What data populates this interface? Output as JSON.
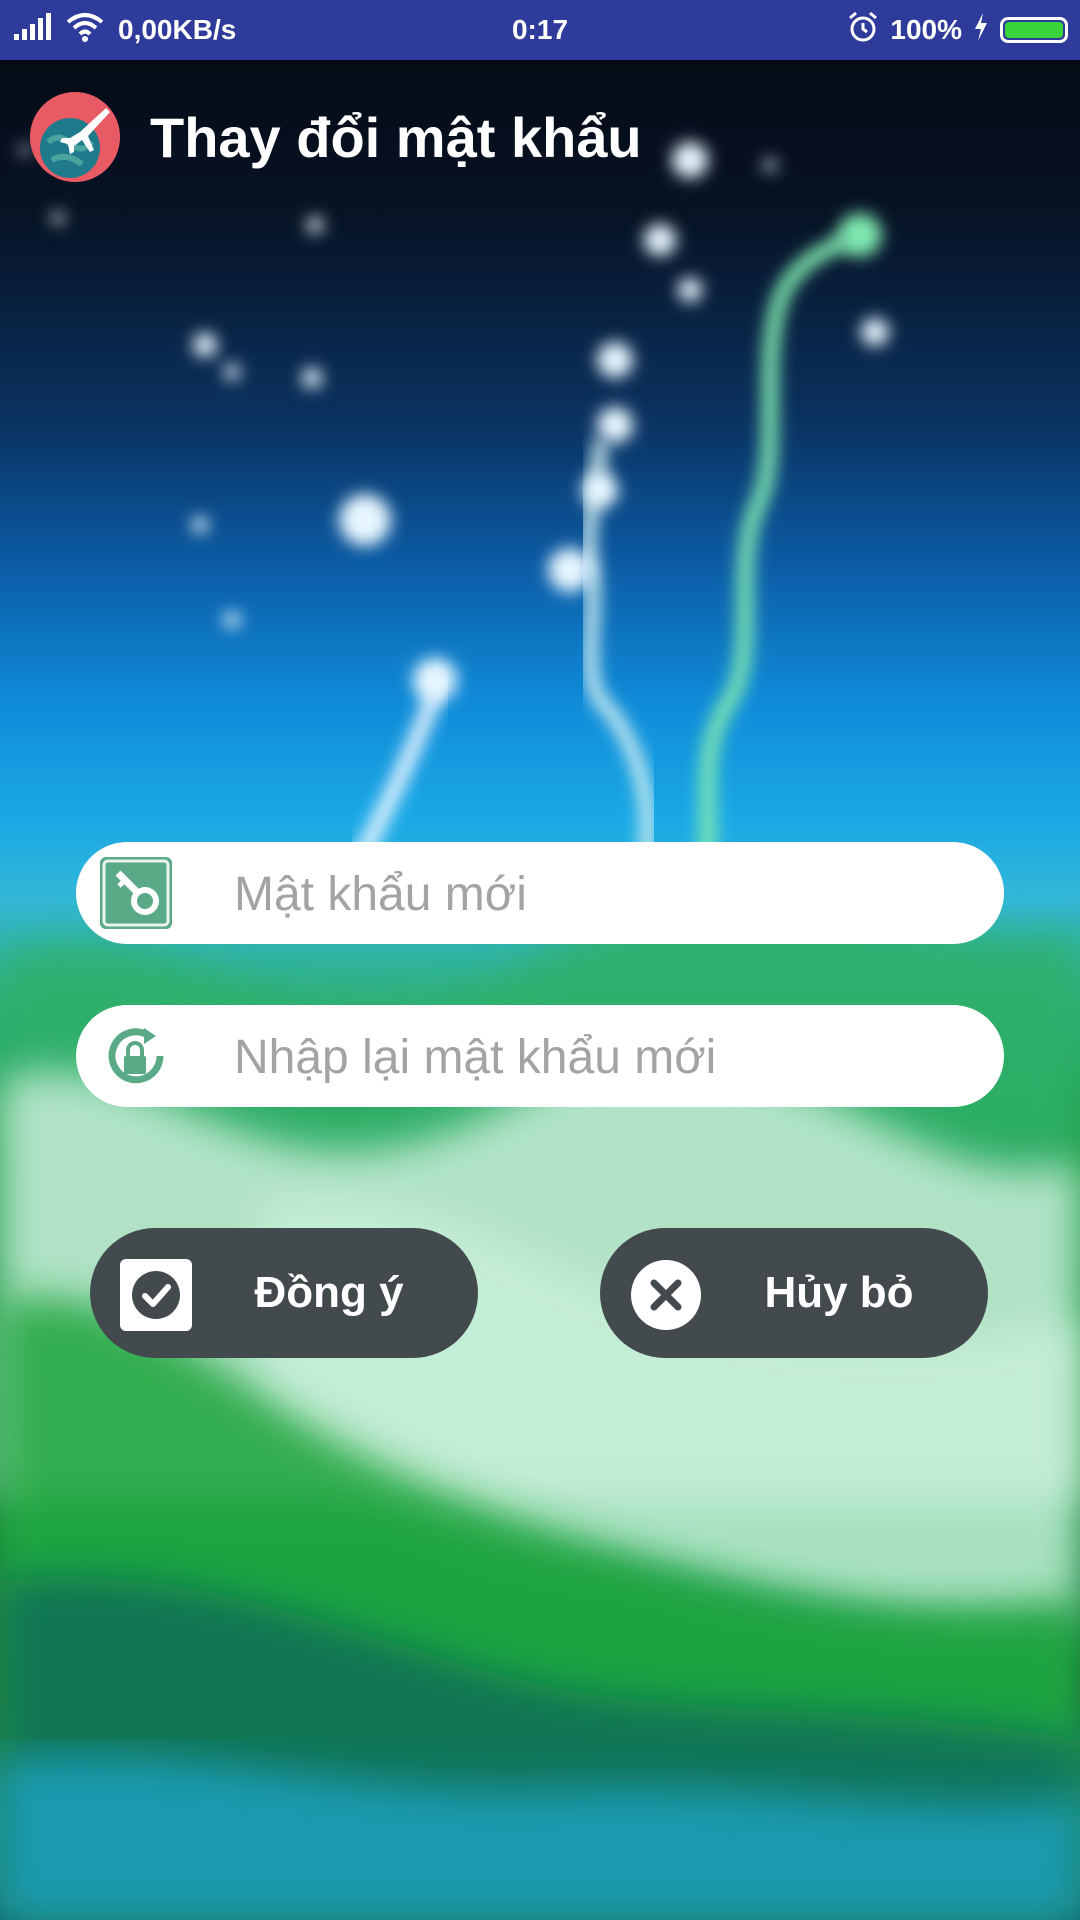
{
  "status_bar": {
    "net_speed": "0,00KB/s",
    "time": "0:17",
    "battery_percent": "100%",
    "battery_level": 1.0,
    "icons": [
      "signal-icon",
      "wifi-icon",
      "alarm-icon",
      "charging-icon",
      "battery-icon"
    ]
  },
  "header": {
    "title": "Thay đổi mật khẩu",
    "app_icon": "globe-airplane-icon"
  },
  "form": {
    "new_password": {
      "value": "",
      "placeholder": "Mật khẩu mới",
      "icon": "key-icon"
    },
    "confirm_password": {
      "value": "",
      "placeholder": "Nhập lại mật khẩu mới",
      "icon": "lock-refresh-icon"
    }
  },
  "buttons": {
    "ok": {
      "label": "Đồng ý",
      "icon": "checkmark-icon"
    },
    "cancel": {
      "label": "Hủy bỏ",
      "icon": "close-icon"
    }
  },
  "colors": {
    "status_bar": "#2e3b9a",
    "button_bg": "#434a4d",
    "field_icon": "#5aa987",
    "text_white": "#ffffff",
    "placeholder": "#a3a3a3"
  }
}
